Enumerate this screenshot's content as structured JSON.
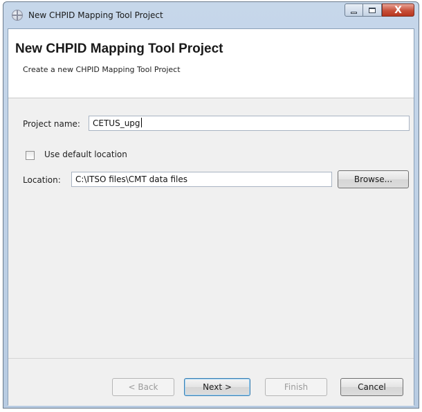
{
  "window": {
    "title": "New CHPID Mapping Tool Project",
    "controls": {
      "minimize": "minimize",
      "maximize": "maximize",
      "close": "X"
    }
  },
  "banner": {
    "title": "New CHPID Mapping Tool Project",
    "subtitle": "Create a new CHPID Mapping Tool Project"
  },
  "form": {
    "project_name_label": "Project name:",
    "project_name_value": "CETUS_upg",
    "use_default_location_label": "Use default location",
    "use_default_location_checked": false,
    "location_label": "Location:",
    "location_value": "C:\\ITSO files\\CMT data files",
    "browse_label": "Browse..."
  },
  "footer": {
    "back_label": "< Back",
    "next_label": "Next >",
    "finish_label": "Finish",
    "cancel_label": "Cancel"
  }
}
